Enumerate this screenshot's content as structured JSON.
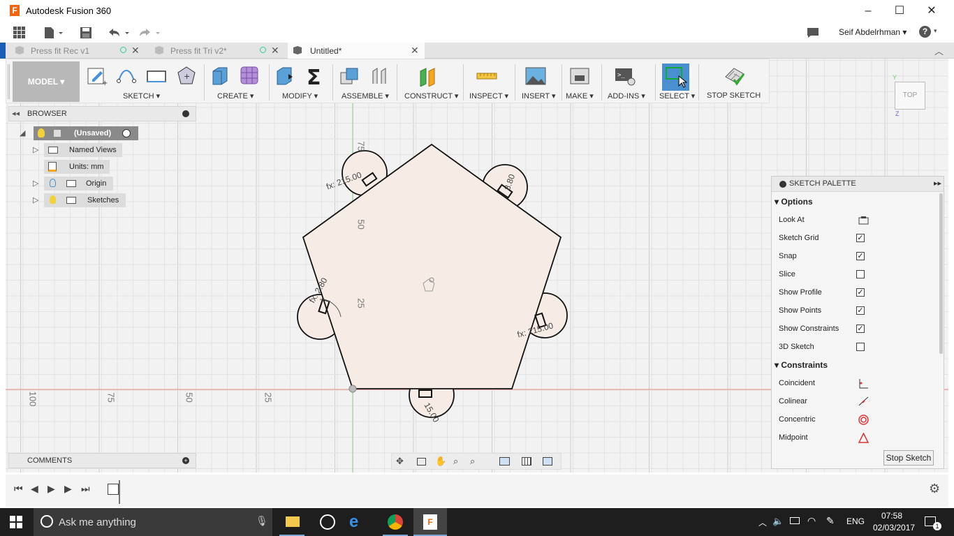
{
  "window": {
    "title": "Autodesk Fusion 360",
    "logo_letter": "F",
    "minimize": "–",
    "maximize": "☐",
    "close": "✕"
  },
  "quick_access": {
    "user": "Seif Abdelrhman",
    "help": "?"
  },
  "tabs": [
    {
      "label": "Press fit Rec v1"
    },
    {
      "label": "Press fit Tri v2*"
    },
    {
      "label": "Untitled*"
    }
  ],
  "toolbar": {
    "workspace": "MODEL ▾",
    "groups": [
      "SKETCH ▾",
      "CREATE ▾",
      "MODIFY ▾",
      "ASSEMBLE ▾",
      "CONSTRUCT ▾",
      "INSPECT ▾",
      "INSERT ▾",
      "MAKE ▾",
      "ADD-INS ▾",
      "SELECT ▾",
      "STOP SKETCH"
    ]
  },
  "browser": {
    "title": "BROWSER",
    "root": "(Unsaved)",
    "items": [
      "Named Views",
      "Units: mm",
      "Origin",
      "Sketches"
    ]
  },
  "comments": {
    "title": "COMMENTS"
  },
  "viewcube": {
    "label": "TOP",
    "axis_y": "Y",
    "axis_z": "Z"
  },
  "axis_labels": {
    "v75": "75",
    "v50": "50",
    "v25": "25",
    "h100": "100",
    "h75": "75",
    "h50": "50",
    "h25": "25"
  },
  "dimensions": {
    "d1": "fx: 215.00",
    "d2": "15.00",
    "d3": "8.80",
    "d4": "fx: 2.80",
    "d5": "fx: 215.00"
  },
  "palette": {
    "title": "SKETCH PALETTE",
    "options_header": "Options",
    "options": [
      {
        "label": "Look At"
      },
      {
        "label": "Sketch Grid",
        "checked": true
      },
      {
        "label": "Snap",
        "checked": true
      },
      {
        "label": "Slice",
        "checked": false
      },
      {
        "label": "Show Profile",
        "checked": true
      },
      {
        "label": "Show Points",
        "checked": true
      },
      {
        "label": "Show Constraints",
        "checked": true
      },
      {
        "label": "3D Sketch",
        "checked": false
      }
    ],
    "constraints_header": "Constraints",
    "constraints": [
      {
        "label": "Coincident"
      },
      {
        "label": "Colinear"
      },
      {
        "label": "Concentric"
      },
      {
        "label": "Midpoint"
      }
    ],
    "stop_button": "Stop Sketch"
  },
  "taskbar": {
    "search_placeholder": "Ask me anything",
    "lang": "ENG",
    "time": "07:58",
    "date": "02/03/2017",
    "notif": "1"
  }
}
